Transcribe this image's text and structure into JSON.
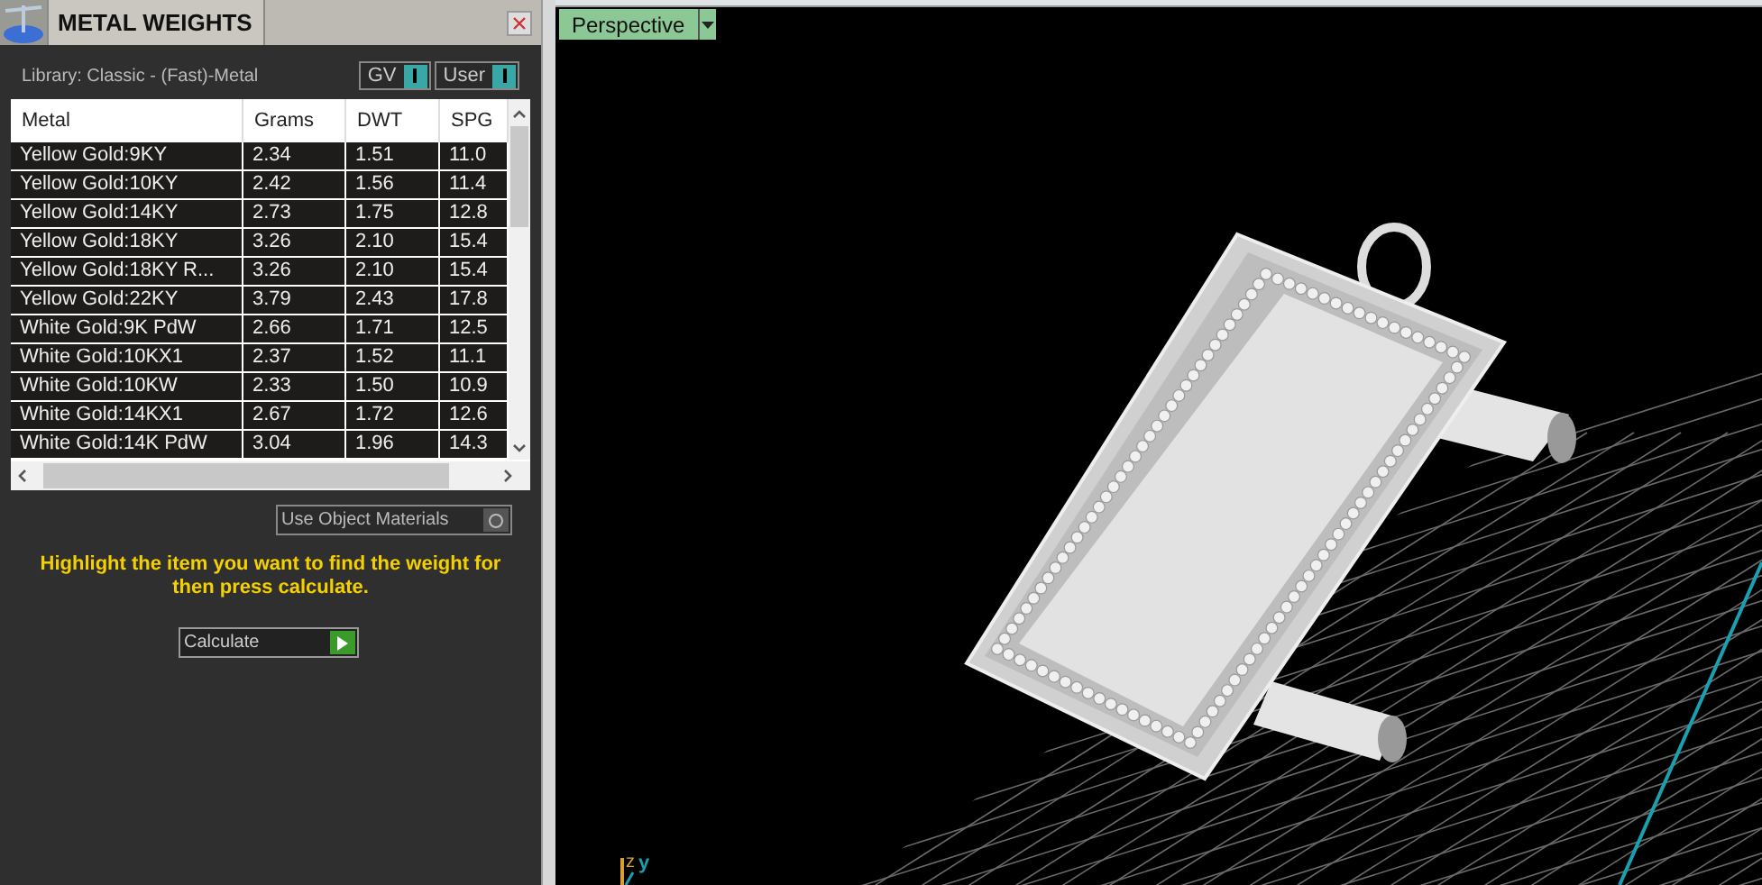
{
  "panel": {
    "title": "METAL WEIGHTS",
    "library": "Library: Classic - (Fast)-Metal",
    "toggles": [
      {
        "label": "GV",
        "on": true
      },
      {
        "label": "User",
        "on": true
      }
    ],
    "table": {
      "columns": [
        "Metal",
        "Grams",
        "DWT",
        "SPG"
      ],
      "rows": [
        {
          "cells": [
            "Yellow Gold:9KY",
            "2.34",
            "1.51",
            "11.0"
          ],
          "selected": false
        },
        {
          "cells": [
            "Yellow Gold:10KY",
            "2.42",
            "1.56",
            "11.4"
          ],
          "selected": false
        },
        {
          "cells": [
            "Yellow Gold:14KY",
            "2.73",
            "1.75",
            "12.8"
          ],
          "selected": false
        },
        {
          "cells": [
            "Yellow Gold:18KY",
            "3.26",
            "2.10",
            "15.4"
          ],
          "selected": false
        },
        {
          "cells": [
            "Yellow Gold:18KY R...",
            "3.26",
            "2.10",
            "15.4"
          ],
          "selected": false
        },
        {
          "cells": [
            "Yellow Gold:22KY",
            "3.79",
            "2.43",
            "17.8"
          ],
          "selected": false
        },
        {
          "cells": [
            "White Gold:9K PdW",
            "2.66",
            "1.71",
            "12.5"
          ],
          "selected": false
        },
        {
          "cells": [
            "White Gold:10KX1",
            "2.37",
            "1.52",
            "11.1"
          ],
          "selected": false
        },
        {
          "cells": [
            "White Gold:10KW",
            "2.33",
            "1.50",
            "10.9"
          ],
          "selected": false
        },
        {
          "cells": [
            "White Gold:14KX1",
            "2.67",
            "1.72",
            "12.6"
          ],
          "selected": false
        },
        {
          "cells": [
            "White Gold:14K PdW",
            "3.04",
            "1.96",
            "14.3"
          ],
          "selected": false
        }
      ]
    },
    "use_object_materials": {
      "label": "Use Object Materials",
      "on": false
    },
    "hint": "Highlight the item you want to find the weight for then press calculate.",
    "calculate": "Calculate"
  },
  "viewport": {
    "view": "Perspective",
    "axes": [
      "z",
      "y"
    ]
  }
}
